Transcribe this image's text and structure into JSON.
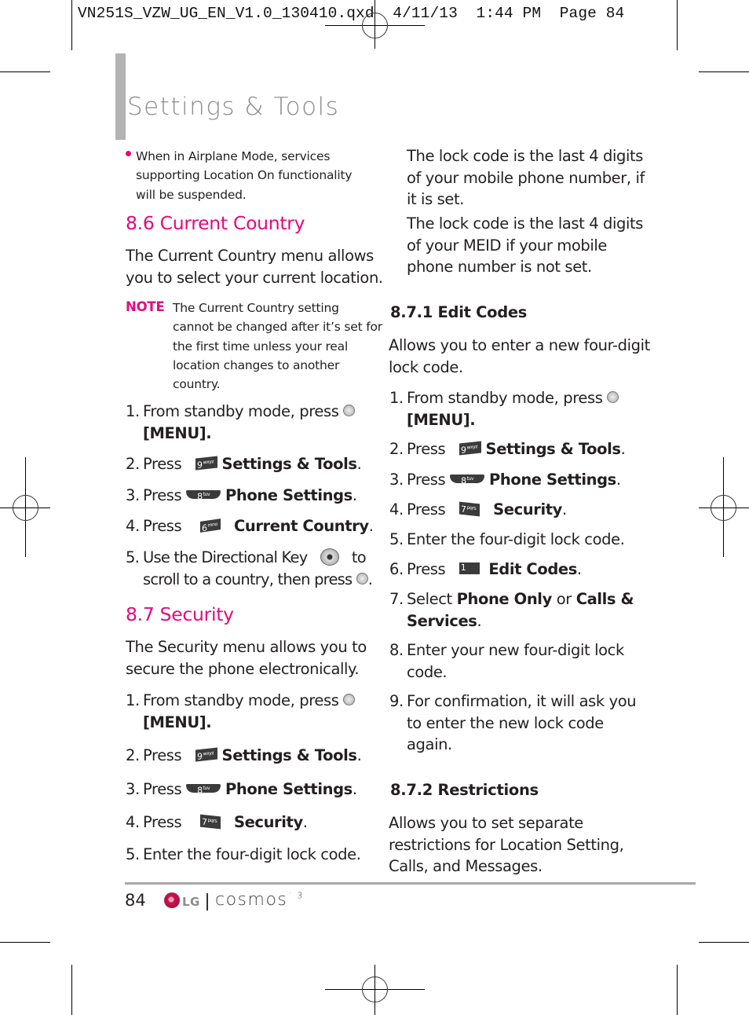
{
  "slug": {
    "filename": "VN251S_VZW_UG_EN_V1.0_130410.qxd",
    "date": "4/11/13",
    "time": "1:44 PM",
    "page_label": "Page 84"
  },
  "chapter_title": "Settings & Tools",
  "left_column": {
    "bullet_note": [
      "When in Airplane Mode, services",
      "supporting Location On functionality",
      "will be suspended."
    ],
    "section_8_6": {
      "heading": "8.6 Current Country",
      "intro": [
        "The Current Country menu allows",
        "you to select your current location."
      ],
      "note_label": "NOTE",
      "note_lines": [
        "The Current Country setting",
        "cannot be changed after it’s set for",
        "the first time unless your real",
        "location changes to another",
        "country."
      ],
      "steps": [
        {
          "num": "1.",
          "pre": "From standby mode, press",
          "line2": "[MENU]."
        },
        {
          "num": "2.",
          "pre": "Press",
          "key": "9",
          "key_sub": "wxyz",
          "bold": "Settings & Tools",
          "post": "."
        },
        {
          "num": "3.",
          "pre": "Press",
          "key": "8",
          "key_sub": "tuv",
          "bold": "Phone Settings",
          "post": "."
        },
        {
          "num": "4.",
          "pre": "Press",
          "key": "6",
          "key_sub": "mno",
          "bold": "Current Country",
          "post": "."
        },
        {
          "num": "5.",
          "pre": "Use the Directional Key",
          "mid": "to",
          "line2": "scroll to a country, then press",
          "post": "."
        }
      ]
    },
    "section_8_7": {
      "heading": "8.7 Security",
      "intro": [
        "The Security menu allows you to",
        "secure the phone electronically."
      ],
      "steps": [
        {
          "num": "1.",
          "pre": "From standby mode, press",
          "line2": "[MENU]."
        },
        {
          "num": "2.",
          "pre": "Press",
          "key": "9",
          "key_sub": "wxyz",
          "bold": "Settings & Tools",
          "post": "."
        },
        {
          "num": "3.",
          "pre": "Press",
          "key": "8",
          "key_sub": "tuv",
          "bold": "Phone Settings",
          "post": "."
        },
        {
          "num": "4.",
          "pre": "Press",
          "key": "7",
          "key_sub": "pqrs",
          "bold": "Security",
          "post": "."
        },
        {
          "num": "5.",
          "text": "Enter the four-digit lock code."
        }
      ]
    }
  },
  "right_column": {
    "lock_info_1": [
      "The lock code is the last 4 digits",
      "of your mobile phone number, if",
      "it is set."
    ],
    "lock_info_2": [
      "The lock code is the last 4 digits",
      "of your MEID if your mobile",
      "phone number is not set."
    ],
    "section_8_7_1": {
      "heading": "8.7.1 Edit Codes",
      "intro": [
        "Allows you to enter a new four-digit",
        "lock code."
      ],
      "steps": [
        {
          "num": "1.",
          "pre": "From standby mode, press",
          "line2": "[MENU]."
        },
        {
          "num": "2.",
          "pre": "Press",
          "key": "9",
          "key_sub": "wxyz",
          "bold": "Settings & Tools",
          "post": "."
        },
        {
          "num": "3.",
          "pre": "Press",
          "key": "8",
          "key_sub": "tuv",
          "bold": "Phone Settings",
          "post": "."
        },
        {
          "num": "4.",
          "pre": "Press",
          "key": "7",
          "key_sub": "pqrs",
          "bold": "Security",
          "post": "."
        },
        {
          "num": "5.",
          "text": "Enter the four-digit lock code."
        },
        {
          "num": "6.",
          "pre": "Press",
          "key": "1",
          "key_sub": "",
          "bold": "Edit Codes",
          "post": "."
        },
        {
          "num": "7.",
          "pre": "Select",
          "bold": "Phone Only",
          "mid": "or",
          "bold2": "Calls &",
          "line2_bold": "Services",
          "post": "."
        },
        {
          "num": "8.",
          "text": "Enter your new four-digit lock",
          "line2": "code."
        },
        {
          "num": "9.",
          "text": "For confirmation, it will ask you",
          "line2": "to enter the new lock code",
          "line3": "again."
        }
      ]
    },
    "section_8_7_2": {
      "heading": "8.7.2 Restrictions",
      "intro": [
        "Allows you to set separate",
        "restrictions for Location Setting,",
        "Calls, and Messages."
      ]
    }
  },
  "footer": {
    "page_number": "84",
    "brand": "LG",
    "product": "cosmos",
    "product_suffix": "3"
  },
  "colors": {
    "accent_magenta": "#e5087e",
    "chapter_gray": "#8c8c8c",
    "sidebar_gray": "#b3b3b3",
    "text": "#231f20"
  }
}
